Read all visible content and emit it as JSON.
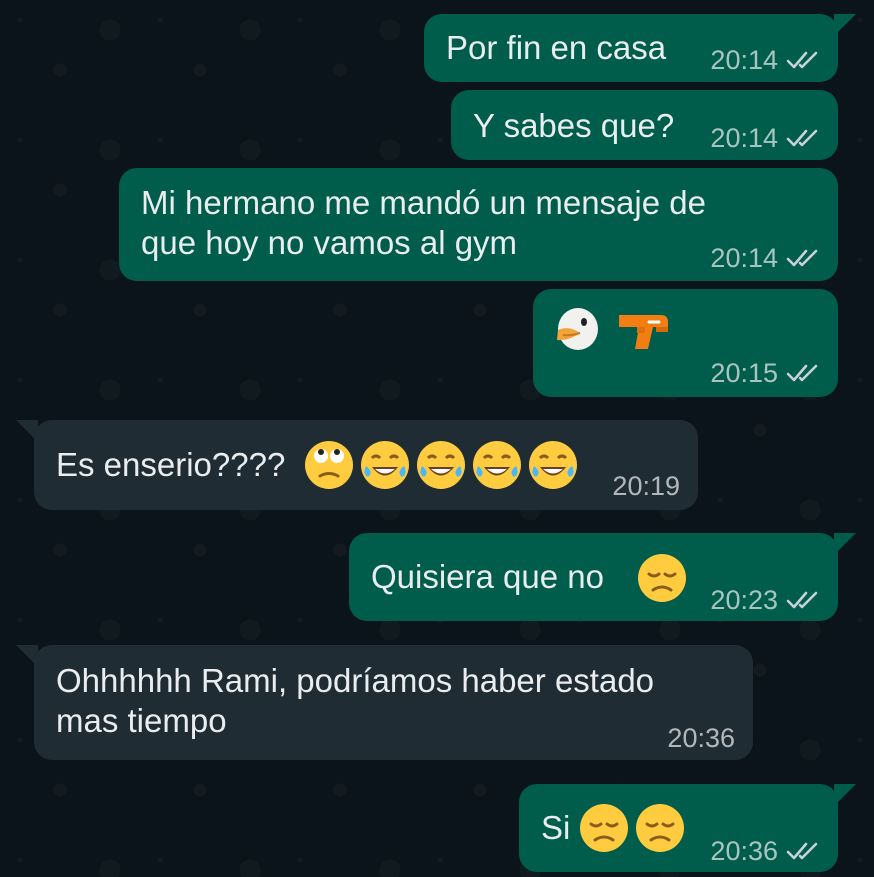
{
  "messages": [
    {
      "direction": "outgoing",
      "text": "Por fin en casa",
      "time": "20:14",
      "status": "read"
    },
    {
      "direction": "outgoing",
      "text": "Y sabes que?",
      "time": "20:14",
      "status": "read"
    },
    {
      "direction": "outgoing",
      "text": "Mi hermano me mandó un mensaje de\nque hoy no vamos al gym",
      "time": "20:14",
      "status": "read"
    },
    {
      "direction": "outgoing",
      "text": "",
      "emoji": [
        "goose-emoji",
        "water-pistol-emoji"
      ],
      "time": "20:15",
      "status": "read"
    },
    {
      "direction": "incoming",
      "text": "Es enserio????",
      "emoji": [
        "face-with-rolling-eyes-emoji",
        "tears-of-joy-emoji",
        "tears-of-joy-emoji",
        "tears-of-joy-emoji",
        "tears-of-joy-emoji"
      ],
      "time": "20:19"
    },
    {
      "direction": "outgoing",
      "text": "Quisiera que no",
      "emoji": [
        "disappointed-face-emoji"
      ],
      "time": "20:23",
      "status": "read"
    },
    {
      "direction": "incoming",
      "text": "Ohhhhhh Rami,  podríamos haber estado\nmas tiempo",
      "time": "20:36"
    },
    {
      "direction": "outgoing",
      "text": "Si",
      "emoji": [
        "disappointed-face-emoji",
        "disappointed-face-emoji"
      ],
      "time": "20:36",
      "status": "read"
    }
  ],
  "colors": {
    "background": "#0b141a",
    "outgoing_bubble": "#005c4b",
    "incoming_bubble": "#202c33",
    "message_text": "#e9edef",
    "read_ticks": "#c8d2d8"
  }
}
